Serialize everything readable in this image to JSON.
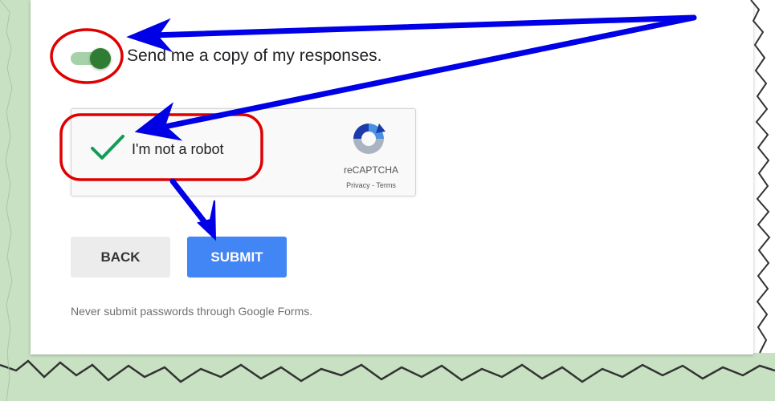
{
  "toggle": {
    "label": "Send me a copy of my responses.",
    "state": "on",
    "color": "#2e7d32"
  },
  "recaptcha": {
    "checkbox_label": "I'm not a robot",
    "checked": true,
    "check_color": "#0f9d58",
    "brand": "reCAPTCHA",
    "links": "Privacy - Terms",
    "logo_icon": "recaptcha-logo-icon"
  },
  "buttons": {
    "back_label": "BACK",
    "submit_label": "SUBMIT",
    "submit_color": "#4285f4"
  },
  "notice": "Never submit passwords through Google Forms.",
  "annotations": {
    "arrow_color": "#0000e6",
    "circle_color": "#e00000"
  }
}
